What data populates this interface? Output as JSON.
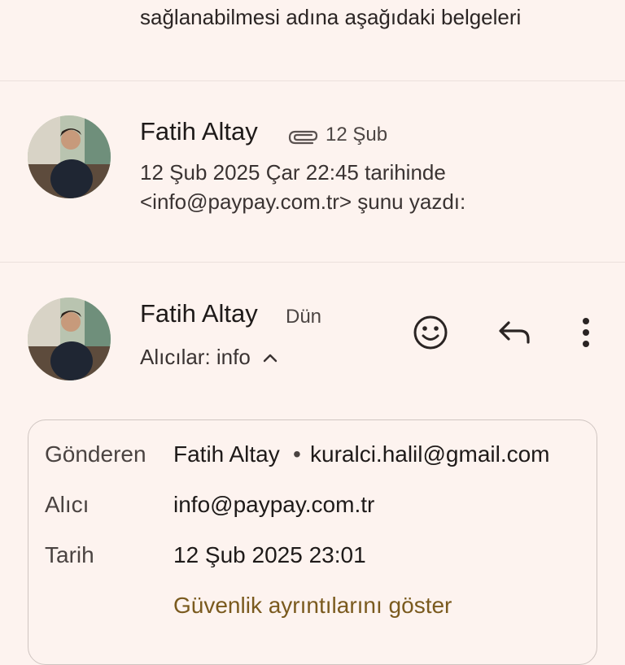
{
  "thread": {
    "top_snippet": "sağlanabilmesi adına aşağıdaki belgeleri"
  },
  "message1": {
    "sender": "Fatih Altay",
    "date": "12 Şub",
    "snippet_line1": "12 Şub 2025 Çar 22:45 tarihinde",
    "snippet_line2": "<info@paypay.com.tr> şunu yazdı:",
    "attachment_icon": "paperclip-icon"
  },
  "message2": {
    "sender": "Fatih Altay",
    "date": "Dün",
    "recipients": "Alıcılar: info",
    "actions": {
      "emoji_icon": "add-reaction-icon",
      "reply_icon": "reply-icon",
      "more_icon": "more-vert-icon"
    },
    "details": {
      "from_label": "Gönderen",
      "from_name": "Fatih Altay",
      "from_separator": "•",
      "from_email": "kuralci.halil@gmail.com",
      "to_label": "Alıcı",
      "to_value": "info@paypay.com.tr",
      "date_label": "Tarih",
      "date_value": "12 Şub 2025 23:01",
      "security_link": "Güvenlik ayrıntılarını göster"
    }
  },
  "colors": {
    "background": "#fdf3ef",
    "link": "#7a5a1e",
    "divider": "#ebe0dc"
  }
}
